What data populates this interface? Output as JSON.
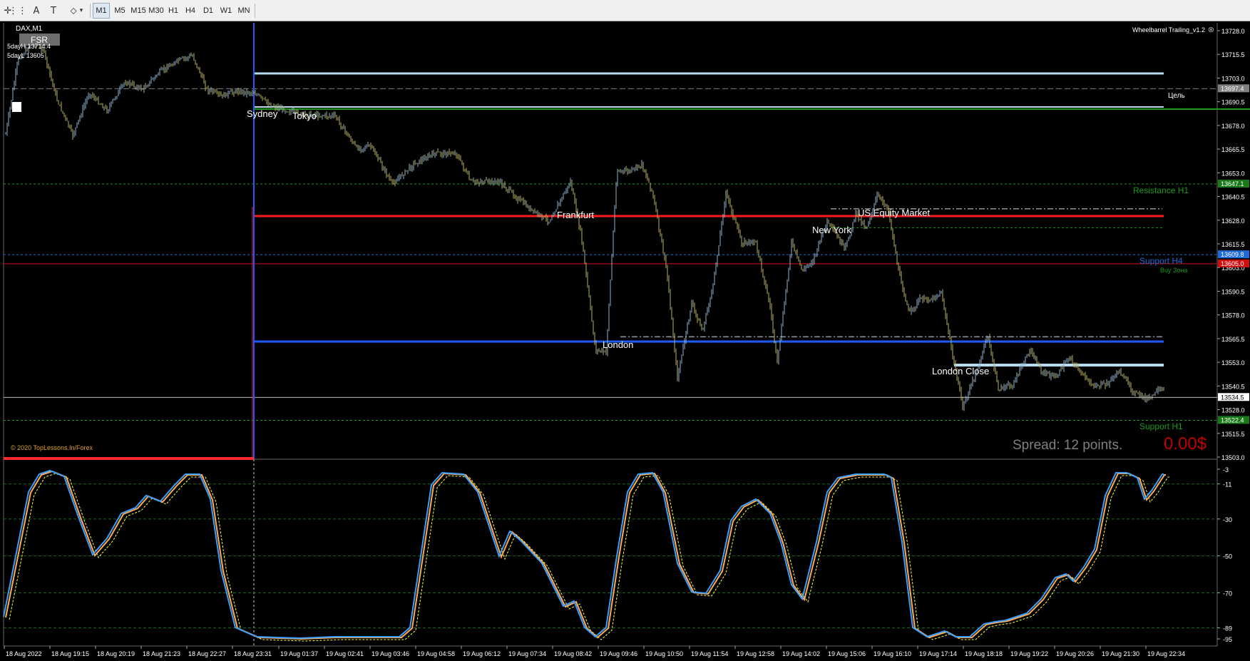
{
  "toolbar": {
    "timeframes": [
      "M1",
      "M5",
      "M15",
      "M30",
      "H1",
      "H4",
      "D1",
      "W1",
      "MN"
    ],
    "active": "M1",
    "icons": [
      "crosshair-icon",
      "grid-icon",
      "text-icon",
      "text-label-icon",
      "objects-icon"
    ],
    "icon_glyphs": [
      "✛",
      "⋮⋮",
      "A",
      "T",
      "⬦"
    ]
  },
  "chart": {
    "symbol": "DAX,M1",
    "fsr_label": "FSR",
    "day_high": "5dayH 13714.4",
    "day_low": "5dayL 13605",
    "indicator_name": "Wheelbarrel Trailing_v1.2",
    "copyright": "© 2020 TopLessons.In/Forex",
    "spread": "Spread: 12 points.",
    "profit": "0.00$",
    "sessions": [
      "Sydney",
      "Tokyo",
      "Frankfurt",
      "London",
      "New York",
      "US Equity Market",
      "London Close"
    ],
    "levels": {
      "target": "Цель",
      "resistance": "Resistance H1",
      "support_h4": "Support H4",
      "buy_zone": "Buy Зона",
      "support_h1": "Support H1"
    },
    "price_axis": [
      "13728.0",
      "13715.5",
      "13703.0",
      "13690.5",
      "13678.0",
      "13665.5",
      "13653.0",
      "13640.5",
      "13628.0",
      "13615.5",
      "13603.0",
      "13590.5",
      "13578.0",
      "13565.5",
      "13553.0",
      "13540.5",
      "13528.0",
      "13515.5",
      "13503.0"
    ],
    "price_tags": [
      {
        "label": "13697.4",
        "price": 13697.4,
        "color": "#808080"
      },
      {
        "label": "13647.1",
        "price": 13647.1,
        "color": "#1a7a1a"
      },
      {
        "label": "13609.8",
        "price": 13609.8,
        "color": "#1e6bd6"
      },
      {
        "label": "13605.0",
        "price": 13605.0,
        "color": "#d01010"
      },
      {
        "label": "13534.5",
        "price": 13534.5,
        "color": "#ffffff"
      },
      {
        "label": "13522.4",
        "price": 13522.4,
        "color": "#1a7a1a"
      }
    ],
    "osc_axis": [
      "-3",
      "-11",
      "-30",
      "-50",
      "-70",
      "-89",
      "-95"
    ],
    "time_axis": [
      "18 Aug 2022",
      "18 Aug 19:15",
      "18 Aug 20:19",
      "18 Aug 21:23",
      "18 Aug 22:27",
      "18 Aug 23:31",
      "19 Aug 01:37",
      "19 Aug 02:41",
      "19 Aug 03:46",
      "19 Aug 04:58",
      "19 Aug 06:12",
      "19 Aug 07:34",
      "19 Aug 08:42",
      "19 Aug 09:46",
      "19 Aug 10:50",
      "19 Aug 11:54",
      "19 Aug 12:58",
      "19 Aug 14:02",
      "19 Aug 15:06",
      "19 Aug 16:10",
      "19 Aug 17:14",
      "19 Aug 18:18",
      "19 Aug 19:22",
      "19 Aug 20:26",
      "19 Aug 21:30",
      "19 Aug 22:34"
    ],
    "colors": {
      "candles": "#b8b060",
      "blue_line": "#1e5bff",
      "red_line": "#ff1a1a",
      "light_blue": "#b8ddf0",
      "green": "#1a9a1a",
      "osc_fast": "#3aa0ff",
      "osc_slow": "#ffaa55",
      "osc_signal": "#ffff40",
      "spread_text": "#808080",
      "profit_text": "#c00000",
      "copyright_text": "#e0a020"
    }
  }
}
